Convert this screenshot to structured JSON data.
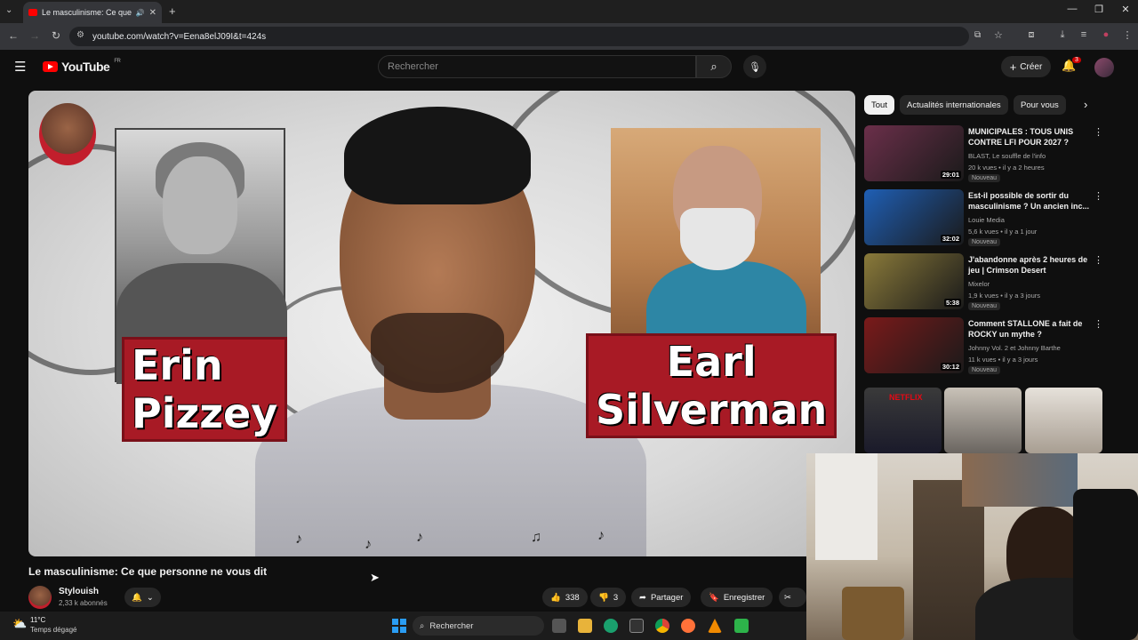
{
  "browser": {
    "tab_title": "Le masculinisme: Ce que pe",
    "url": "youtube.com/watch?v=Eena8elJ09I&t=424s",
    "icons": [
      "dropdown-icon",
      "audio-icon",
      "close-icon",
      "new-tab-icon",
      "back-icon",
      "forward-icon",
      "reload-icon",
      "site-info-icon",
      "install-icon",
      "bookmark-star-icon",
      "extensions-icon",
      "download-icon",
      "media-icon",
      "profile-icon",
      "menu-icon"
    ]
  },
  "header": {
    "brand": "YouTube",
    "country": "FR",
    "search_placeholder": "Rechercher",
    "create_label": "Créer",
    "notifications_count": "3"
  },
  "video": {
    "overlay": {
      "left_name_line1": "Erin",
      "left_name_line2": "Pizzey",
      "right_name_line1": "Earl",
      "right_name_line2": "Silverman"
    },
    "title": "Le masculinisme: Ce que personne ne vous dit",
    "channel": "Stylouish",
    "subscribers": "2,33 k abonnés",
    "likes": "338",
    "dislikes": "3",
    "share_label": "Partager",
    "save_label": "Enregistrer"
  },
  "sidebar": {
    "chips": [
      "Tout",
      "Actualités internationales",
      "Pour vous"
    ],
    "recommendations": [
      {
        "title": "MUNICIPALES : TOUS UNIS CONTRE LFI POUR 2027 ?",
        "channel": "BLAST, Le souffle de l'info",
        "meta": "20 k vues • il y a 2 heures",
        "badge": "Nouveau",
        "duration": "29:01",
        "thumb_color": "#6b2f4a"
      },
      {
        "title": "Est-il possible de sortir du masculinisme ? Un ancien inc...",
        "channel": "Louie Media",
        "meta": "5,6 k vues • il y a 1 jour",
        "badge": "Nouveau",
        "duration": "32:02",
        "thumb_color": "#1f5fb5"
      },
      {
        "title": "J'abandonne après 2 heures de jeu | Crimson Desert",
        "channel": "Mixelor",
        "meta": "1,9 k vues • il y a 3 jours",
        "badge": "Nouveau",
        "duration": "5:38",
        "thumb_color": "#8a7a3a"
      },
      {
        "title": "Comment STALLONE a fait de ROCKY un mythe ?",
        "channel": "Johnny Vol. 2 et Johnny Barthe",
        "meta": "11 k vues • il y a 3 jours",
        "badge": "Nouveau",
        "duration": "30:12",
        "thumb_color": "#7a1a1a"
      }
    ],
    "shorts_label": "NETFLIX"
  },
  "taskbar": {
    "weather_temp": "11°C",
    "weather_desc": "Temps dégagé",
    "search_label": "Rechercher"
  },
  "colors": {
    "brand_red": "#ff0000",
    "name_plate": "#a81a25",
    "page_bg": "#0f0f0f"
  }
}
